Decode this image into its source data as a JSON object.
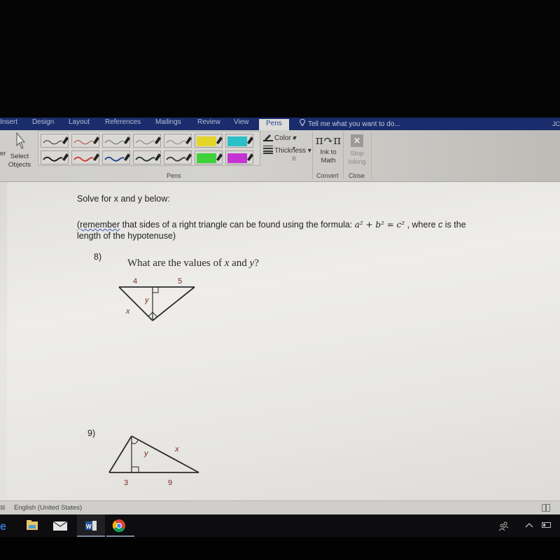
{
  "ribbon": {
    "tabs": [
      {
        "label": "Insert",
        "active": false
      },
      {
        "label": "Design",
        "active": false
      },
      {
        "label": "Layout",
        "active": false
      },
      {
        "label": "References",
        "active": false
      },
      {
        "label": "Mailings",
        "active": false
      },
      {
        "label": "Review",
        "active": false
      },
      {
        "label": "View",
        "active": false
      },
      {
        "label": "Pens",
        "active": true
      }
    ],
    "tell_me": "Tell me what you want to do...",
    "user_initial": "JC",
    "select_objects_label": "Select Objects",
    "select_label_line1": "Select",
    "select_label_line2": "Objects",
    "partial_left_label": "er",
    "pens": {
      "group_label": "Pens",
      "row1": [
        {
          "type": "pen",
          "color": "#3a2a28"
        },
        {
          "type": "pen",
          "color": "#b5463f"
        },
        {
          "type": "pen",
          "color": "#6a6a6e"
        },
        {
          "type": "pen",
          "color": "#7a7a70"
        },
        {
          "type": "pen",
          "color": "#8a8580"
        },
        {
          "type": "highlighter",
          "color": "#e4d52a"
        },
        {
          "type": "highlighter",
          "color": "#2bbfc9"
        }
      ],
      "row2": [
        {
          "type": "pen",
          "color": "#111111"
        },
        {
          "type": "pen",
          "color": "#d1362d"
        },
        {
          "type": "pen",
          "color": "#1e3f93"
        },
        {
          "type": "pen",
          "color": "#1f3424"
        },
        {
          "type": "pen",
          "color": "#3a3633"
        },
        {
          "type": "highlighter",
          "color": "#3fd23b"
        },
        {
          "type": "highlighter",
          "color": "#c633d3"
        }
      ]
    },
    "color_label": "Color",
    "thickness_label": "Thickness",
    "ink_to_math_line1": "Ink to",
    "ink_to_math_line2": "Math",
    "stop_inking_line1": "Stop",
    "stop_inking_line2": "Inking",
    "convert_group": "Convert",
    "close_group": "Close"
  },
  "document": {
    "instruction": "Solve for x and y below:",
    "reminder_word": "(remember",
    "reminder_rest": " that sides of a right triangle can be found using the formula: ",
    "formula": "a² + b² = c²",
    "reminder_tail": " , where ",
    "c_var": "c",
    "reminder_end": " is the",
    "reminder_line2": "length of the hypotenuse)",
    "problem8": {
      "number": "8)",
      "question_prefix": "What are the values of ",
      "x": "x",
      "and": " and ",
      "y": "y",
      "suffix": "?",
      "labels": {
        "left_segment": "4",
        "right_segment": "5",
        "altitude": "y",
        "leg": "x"
      }
    },
    "problem9": {
      "number": "9)",
      "labels": {
        "left_segment": "3",
        "right_segment": "9",
        "altitude": "y",
        "hypotenuse_side": "x"
      }
    }
  },
  "statusbar": {
    "language": "English (United States)"
  },
  "taskbar": {
    "apps": [
      {
        "name": "Edge",
        "active": false
      },
      {
        "name": "File Explorer",
        "active": false
      },
      {
        "name": "Mail",
        "active": false
      },
      {
        "name": "Word",
        "active": true
      },
      {
        "name": "Chrome",
        "active": false
      }
    ]
  }
}
